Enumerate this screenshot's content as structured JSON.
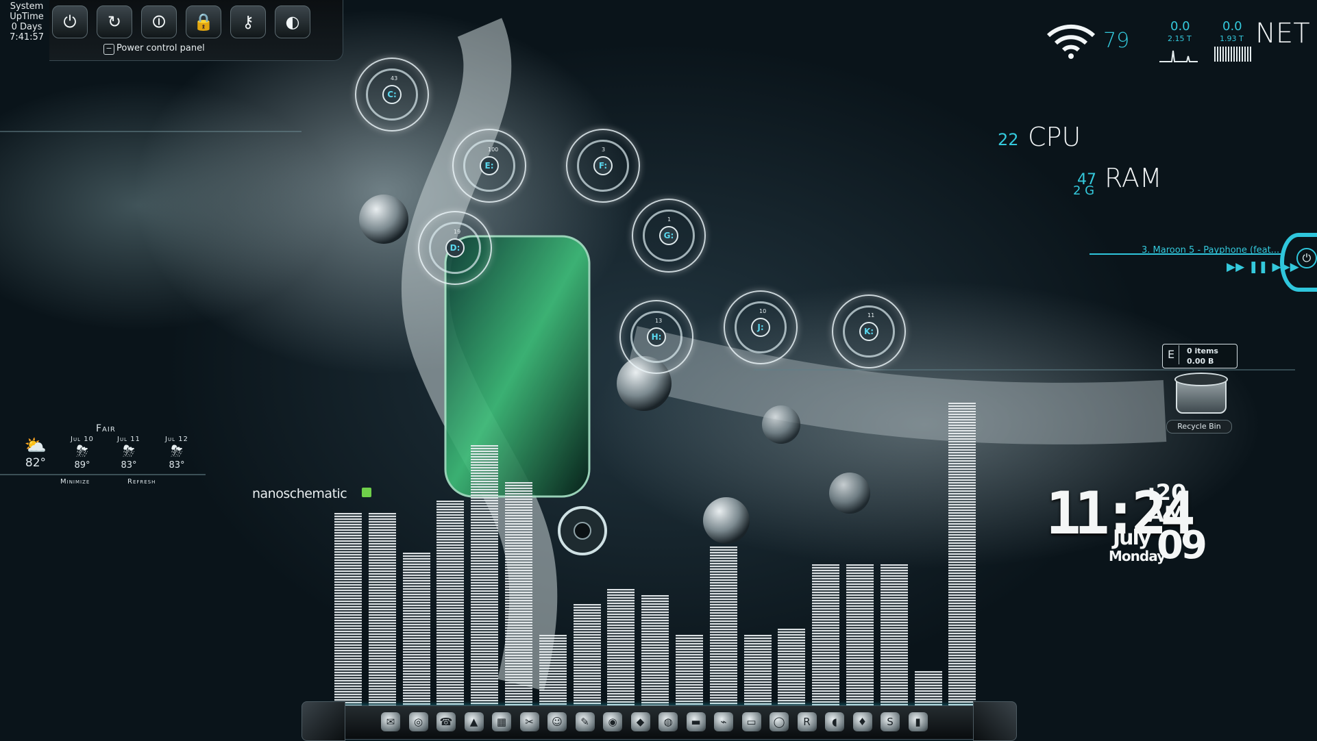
{
  "uptime": {
    "line1": "System",
    "line2": "UpTime",
    "line3": "0 Days",
    "line4": "7:41:57"
  },
  "power_panel": {
    "label": "Power control panel",
    "toggle": "−",
    "buttons": [
      {
        "name": "shutdown",
        "icon": "power-icon",
        "glyph": "⏻"
      },
      {
        "name": "restart",
        "icon": "restart-icon",
        "glyph": "↻"
      },
      {
        "name": "sleep",
        "icon": "standby-icon",
        "glyph": "⏼"
      },
      {
        "name": "lock",
        "icon": "lock-icon",
        "glyph": "🔒"
      },
      {
        "name": "logoff",
        "icon": "key-icon",
        "glyph": "⚷"
      },
      {
        "name": "hibernate",
        "icon": "half-circle-icon",
        "glyph": "◐"
      }
    ]
  },
  "drives": [
    {
      "letter": "C:",
      "pct": "43"
    },
    {
      "letter": "E:",
      "pct": "100"
    },
    {
      "letter": "F:",
      "pct": "3"
    },
    {
      "letter": "D:",
      "pct": "19"
    },
    {
      "letter": "G:",
      "pct": "1"
    },
    {
      "letter": "H:",
      "pct": "13"
    },
    {
      "letter": "J:",
      "pct": "10"
    },
    {
      "letter": "K:",
      "pct": "11"
    }
  ],
  "network": {
    "wifi_strength": "79",
    "down_value": "0.0",
    "down_total": "2.15 T",
    "up_value": "0.0",
    "up_total": "1.93 T",
    "label": "NET"
  },
  "cpu": {
    "value": "22",
    "label": "CPU"
  },
  "ram": {
    "value": "47",
    "size": "2 G",
    "label": "RAM"
  },
  "media": {
    "track": "3. Maroon 5 - Payphone (feat...",
    "controls": "▶▶ ❚❚ ▶▶▶"
  },
  "recycle_bin": {
    "drive": "E",
    "items": "0 items",
    "size": "0.00 B",
    "label": "Recycle Bin"
  },
  "clock": {
    "time": "11:24",
    "seconds": ":20",
    "ampm": "AM",
    "month": "July",
    "weekday": "Monday",
    "day": "09"
  },
  "weather": {
    "condition": "Fair",
    "current_temp": "82°",
    "forecast": [
      {
        "date": "Jul 10",
        "temp": "89°"
      },
      {
        "date": "Jul 11",
        "temp": "83°"
      },
      {
        "date": "Jul 12",
        "temp": "83°"
      }
    ],
    "minimize": "Minimize",
    "refresh": "Refresh"
  },
  "nanoschematic": {
    "title": "nanoschematic"
  },
  "visualizer": {
    "levels": [
      0.64,
      0.64,
      0.51,
      0.68,
      0.86,
      0.74,
      0.24,
      0.34,
      0.39,
      0.37,
      0.24,
      0.53,
      0.24,
      0.26,
      0.47,
      0.47,
      0.47,
      0.12,
      1.0
    ]
  },
  "dock": {
    "icons": [
      "finder-icon",
      "disk-icon",
      "phone-icon",
      "cone-icon",
      "calendar-icon",
      "scissors-icon",
      "smile-icon",
      "paint-icon",
      "alien-icon",
      "tag-icon",
      "target-icon",
      "film-icon",
      "usb-icon",
      "drive-icon",
      "dvd-icon",
      "r-icon",
      "stone-icon",
      "drop-icon",
      "skype-icon",
      "trash-icon"
    ]
  }
}
